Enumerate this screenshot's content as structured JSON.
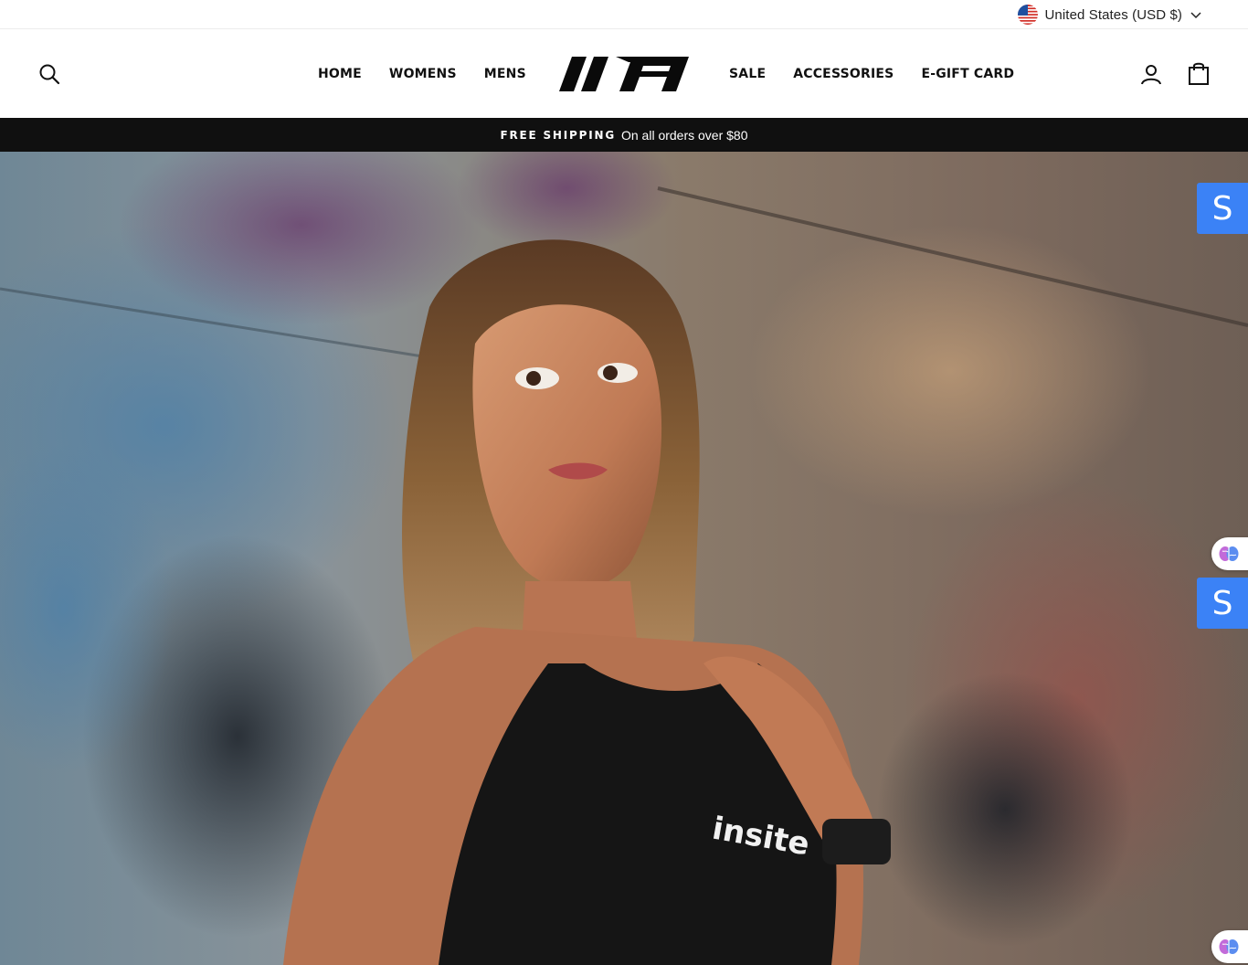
{
  "utility_bar": {
    "currency_label": "United States (USD $)",
    "flag_icon": "us-flag-icon",
    "chevron_icon": "chevron-down-icon"
  },
  "header": {
    "search_icon": "search-icon",
    "nav_left": [
      {
        "label": "HOME"
      },
      {
        "label": "WOMENS"
      },
      {
        "label": "MENS"
      }
    ],
    "logo_alt": "brand logo",
    "nav_right": [
      {
        "label": "SALE"
      },
      {
        "label": "ACCESSORIES"
      },
      {
        "label": "E-GIFT CARD"
      }
    ],
    "account_icon": "user-icon",
    "cart_icon": "shopping-bag-icon"
  },
  "announcement": {
    "strong": "FREE SHIPPING",
    "text": "On all orders over $80",
    "background": "#101010"
  },
  "hero": {
    "shirt_brand_text": "insite"
  },
  "widgets": {
    "s_badge_label": "S",
    "s_badge_color": "#3b82f6",
    "brain_icon": "brain-icon"
  }
}
